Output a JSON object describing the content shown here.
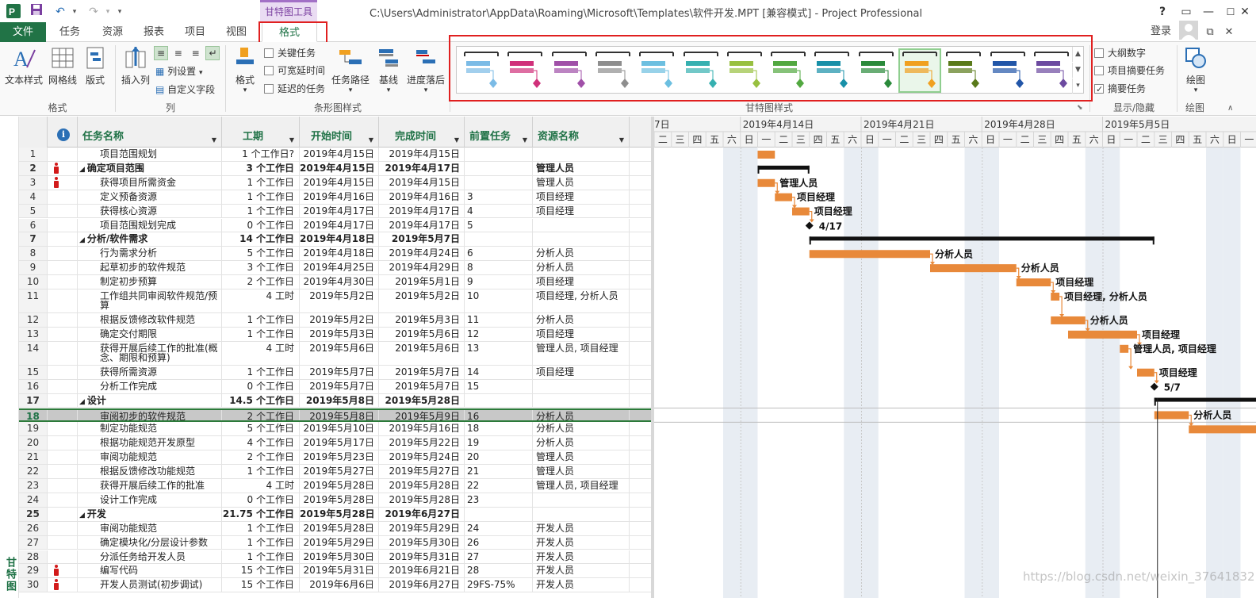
{
  "app": {
    "window_title": "C:\\Users\\Administrator\\AppData\\Roaming\\Microsoft\\Templates\\软件开发.MPT [兼容模式] - Project Professional",
    "context_tab_group": "甘特图工具",
    "signin": "登录",
    "help": "?",
    "side_view_label": "甘特图",
    "watermark": "https://blog.csdn.net/weixin_37641832"
  },
  "tabs": [
    "文件",
    "任务",
    "资源",
    "报表",
    "项目",
    "视图",
    "格式"
  ],
  "ribbon": {
    "groups": {
      "format": "格式",
      "columns": "列",
      "bar_styles": "条形图样式",
      "gantt_styles": "甘特图样式",
      "show_hide": "显示/隐藏",
      "drawings": "绘图"
    },
    "buttons": {
      "text_styles": "文本样式",
      "gridlines": "网格线",
      "layout": "版式",
      "insert_column": "插入列",
      "column_settings": "列设置",
      "custom_fields": "自定义字段",
      "format": "格式",
      "task_path": "任务路径",
      "baseline": "基线",
      "slippage": "进度落后",
      "drawing": "绘图"
    },
    "checkboxes": {
      "critical_tasks": {
        "label": "关键任务",
        "checked": false
      },
      "slack": {
        "label": "可宽延时间",
        "checked": false
      },
      "late_tasks": {
        "label": "延迟的任务",
        "checked": false
      },
      "outline_number": {
        "label": "大纲数字",
        "checked": false
      },
      "project_summary": {
        "label": "项目摘要任务",
        "checked": false
      },
      "summary_tasks": {
        "label": "摘要任务",
        "checked": true
      }
    },
    "gantt_style_colors": [
      "#7bbbe6",
      "#d0307a",
      "#a050a8",
      "#8e8e8e",
      "#6cbfe0",
      "#36b0b0",
      "#98c040",
      "#52a840",
      "#1890a8",
      "#2a8a3a",
      "#f0a020",
      "#5a7a1a",
      "#2256a8",
      "#6c4aa0"
    ],
    "gantt_style_selected_index": 10
  },
  "grid": {
    "columns": {
      "name": "任务名称",
      "duration": "工期",
      "start": "开始时间",
      "finish": "完成时间",
      "predecessors": "前置任务",
      "resources": "资源名称"
    },
    "rows": [
      {
        "id": "1",
        "name": "项目范围规划",
        "dur": "1 个工作日?",
        "start": "2019年4月15日",
        "finish": "2019年4月15日",
        "pred": "",
        "res": "",
        "summary": false,
        "level": 1,
        "person": false
      },
      {
        "id": "2",
        "name": "确定项目范围",
        "dur": "3 个工作日",
        "start": "2019年4月15日",
        "finish": "2019年4月17日",
        "pred": "",
        "res": "管理人员",
        "summary": true,
        "level": 0,
        "person": true
      },
      {
        "id": "3",
        "name": "获得项目所需资金",
        "dur": "1 个工作日",
        "start": "2019年4月15日",
        "finish": "2019年4月15日",
        "pred": "",
        "res": "管理人员",
        "summary": false,
        "level": 1,
        "person": true
      },
      {
        "id": "4",
        "name": "定义预备资源",
        "dur": "1 个工作日",
        "start": "2019年4月16日",
        "finish": "2019年4月16日",
        "pred": "3",
        "res": "项目经理",
        "summary": false,
        "level": 1,
        "person": false
      },
      {
        "id": "5",
        "name": "获得核心资源",
        "dur": "1 个工作日",
        "start": "2019年4月17日",
        "finish": "2019年4月17日",
        "pred": "4",
        "res": "项目经理",
        "summary": false,
        "level": 1,
        "person": false
      },
      {
        "id": "6",
        "name": "项目范围规划完成",
        "dur": "0 个工作日",
        "start": "2019年4月17日",
        "finish": "2019年4月17日",
        "pred": "5",
        "res": "",
        "summary": false,
        "level": 1,
        "person": false
      },
      {
        "id": "7",
        "name": "分析/软件需求",
        "dur": "14 个工作日",
        "start": "2019年4月18日",
        "finish": "2019年5月7日",
        "pred": "",
        "res": "",
        "summary": true,
        "level": 0,
        "person": false
      },
      {
        "id": "8",
        "name": "行为需求分析",
        "dur": "5 个工作日",
        "start": "2019年4月18日",
        "finish": "2019年4月24日",
        "pred": "6",
        "res": "分析人员",
        "summary": false,
        "level": 1,
        "person": false
      },
      {
        "id": "9",
        "name": "起草初步的软件规范",
        "dur": "3 个工作日",
        "start": "2019年4月25日",
        "finish": "2019年4月29日",
        "pred": "8",
        "res": "分析人员",
        "summary": false,
        "level": 1,
        "person": false
      },
      {
        "id": "10",
        "name": "制定初步预算",
        "dur": "2 个工作日",
        "start": "2019年4月30日",
        "finish": "2019年5月1日",
        "pred": "9",
        "res": "项目经理",
        "summary": false,
        "level": 1,
        "person": false
      },
      {
        "id": "11",
        "name": "工作组共同审阅软件规范/预算",
        "dur": "4 工时",
        "start": "2019年5月2日",
        "finish": "2019年5月2日",
        "pred": "10",
        "res": "项目经理, 分析人员",
        "summary": false,
        "level": 1,
        "person": false,
        "tall": true
      },
      {
        "id": "12",
        "name": "根据反馈修改软件规范",
        "dur": "1 个工作日",
        "start": "2019年5月2日",
        "finish": "2019年5月3日",
        "pred": "11",
        "res": "分析人员",
        "summary": false,
        "level": 1,
        "person": false
      },
      {
        "id": "13",
        "name": "确定交付期限",
        "dur": "1 个工作日",
        "start": "2019年5月3日",
        "finish": "2019年5月6日",
        "pred": "12",
        "res": "项目经理",
        "summary": false,
        "level": 1,
        "person": false
      },
      {
        "id": "14",
        "name": "获得开展后续工作的批准(概念、期限和预算)",
        "dur": "4 工时",
        "start": "2019年5月6日",
        "finish": "2019年5月6日",
        "pred": "13",
        "res": "管理人员, 项目经理",
        "summary": false,
        "level": 1,
        "person": false,
        "tall": true
      },
      {
        "id": "15",
        "name": "获得所需资源",
        "dur": "1 个工作日",
        "start": "2019年5月7日",
        "finish": "2019年5月7日",
        "pred": "14",
        "res": "项目经理",
        "summary": false,
        "level": 1,
        "person": false
      },
      {
        "id": "16",
        "name": "分析工作完成",
        "dur": "0 个工作日",
        "start": "2019年5月7日",
        "finish": "2019年5月7日",
        "pred": "15",
        "res": "",
        "summary": false,
        "level": 1,
        "person": false
      },
      {
        "id": "17",
        "name": "设计",
        "dur": "14.5 个工作日",
        "start": "2019年5月8日",
        "finish": "2019年5月28日",
        "pred": "",
        "res": "",
        "summary": true,
        "level": 0,
        "person": false
      },
      {
        "id": "18",
        "name": "审阅初步的软件规范",
        "dur": "2 个工作日",
        "start": "2019年5月8日",
        "finish": "2019年5月9日",
        "pred": "16",
        "res": "分析人员",
        "summary": false,
        "level": 1,
        "person": false,
        "selected": true
      },
      {
        "id": "19",
        "name": "制定功能规范",
        "dur": "5 个工作日",
        "start": "2019年5月10日",
        "finish": "2019年5月16日",
        "pred": "18",
        "res": "分析人员",
        "summary": false,
        "level": 1,
        "person": false
      },
      {
        "id": "20",
        "name": "根据功能规范开发原型",
        "dur": "4 个工作日",
        "start": "2019年5月17日",
        "finish": "2019年5月22日",
        "pred": "19",
        "res": "分析人员",
        "summary": false,
        "level": 1,
        "person": false
      },
      {
        "id": "21",
        "name": "审阅功能规范",
        "dur": "2 个工作日",
        "start": "2019年5月23日",
        "finish": "2019年5月24日",
        "pred": "20",
        "res": "管理人员",
        "summary": false,
        "level": 1,
        "person": false
      },
      {
        "id": "22",
        "name": "根据反馈修改功能规范",
        "dur": "1 个工作日",
        "start": "2019年5月27日",
        "finish": "2019年5月27日",
        "pred": "21",
        "res": "管理人员",
        "summary": false,
        "level": 1,
        "person": false
      },
      {
        "id": "23",
        "name": "获得开展后续工作的批准",
        "dur": "4 工时",
        "start": "2019年5月28日",
        "finish": "2019年5月28日",
        "pred": "22",
        "res": "管理人员, 项目经理",
        "summary": false,
        "level": 1,
        "person": false
      },
      {
        "id": "24",
        "name": "设计工作完成",
        "dur": "0 个工作日",
        "start": "2019年5月28日",
        "finish": "2019年5月28日",
        "pred": "23",
        "res": "",
        "summary": false,
        "level": 1,
        "person": false
      },
      {
        "id": "25",
        "name": "开发",
        "dur": "21.75 个工作日",
        "start": "2019年5月28日",
        "finish": "2019年6月27日",
        "pred": "",
        "res": "",
        "summary": true,
        "level": 0,
        "person": false
      },
      {
        "id": "26",
        "name": "审阅功能规范",
        "dur": "1 个工作日",
        "start": "2019年5月28日",
        "finish": "2019年5月29日",
        "pred": "24",
        "res": "开发人员",
        "summary": false,
        "level": 1,
        "person": false
      },
      {
        "id": "27",
        "name": "确定模块化/分层设计参数",
        "dur": "1 个工作日",
        "start": "2019年5月29日",
        "finish": "2019年5月30日",
        "pred": "26",
        "res": "开发人员",
        "summary": false,
        "level": 1,
        "person": false
      },
      {
        "id": "28",
        "name": "分派任务给开发人员",
        "dur": "1 个工作日",
        "start": "2019年5月30日",
        "finish": "2019年5月31日",
        "pred": "27",
        "res": "开发人员",
        "summary": false,
        "level": 1,
        "person": false
      },
      {
        "id": "29",
        "name": "编写代码",
        "dur": "15 个工作日",
        "start": "2019年5月31日",
        "finish": "2019年6月21日",
        "pred": "28",
        "res": "开发人员",
        "summary": false,
        "level": 1,
        "person": true
      },
      {
        "id": "30",
        "name": "开发人员测试(初步调试)",
        "dur": "15 个工作日",
        "start": "2019年6月6日",
        "finish": "2019年6月27日",
        "pred": "29FS-75%",
        "res": "开发人员",
        "summary": false,
        "level": 1,
        "person": true
      }
    ]
  },
  "timescale": {
    "week_labels": [
      "7日",
      "2019年4月14日",
      "2019年4月21日",
      "2019年4月28日",
      "2019年5月5日"
    ],
    "weekday_labels": [
      "二",
      "三",
      "四",
      "五",
      "六",
      "日",
      "一"
    ],
    "first_day": "2019-04-09",
    "days_shown": 35,
    "gantt_labels": [
      "管理人员",
      "项目经理",
      "项目经理",
      "4/17",
      "分析人员",
      "分析人员",
      "项目经理",
      "项目经理, 分析人员",
      "分析人员",
      "项目经理",
      "管理人员, 项目经理",
      "项目经理",
      "5/7",
      "分析人员"
    ]
  }
}
